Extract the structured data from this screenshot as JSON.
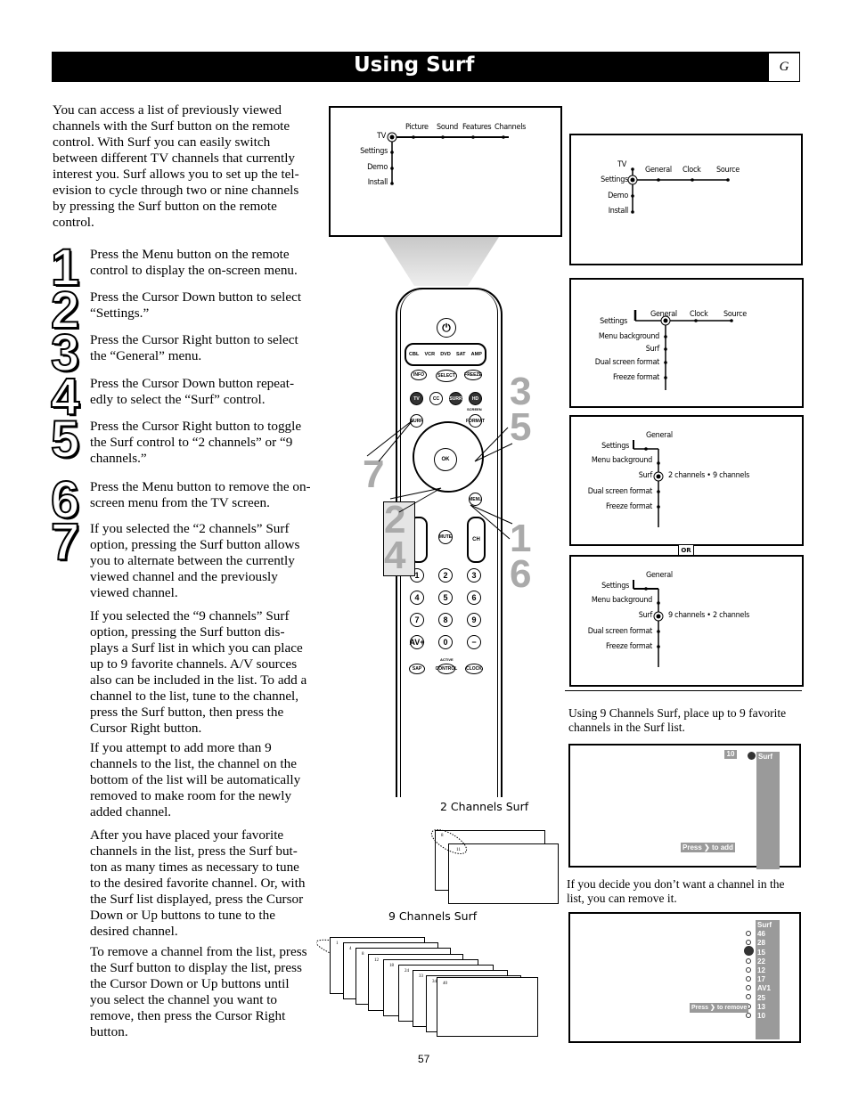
{
  "header": {
    "title": "Using Surf",
    "section_letter": "G"
  },
  "intro": "You can access a list of previously viewed channels with the Surf button on the remote control. With Surf you can easily switch between different TV channels that currently interest you. Surf allows you to set up the tel-evision to cycle through two or nine channels by pressing the Surf button on the remote control.",
  "steps": [
    {
      "num": "1",
      "text": "Press the Menu button on the remote control to display the on-screen menu."
    },
    {
      "num": "2",
      "text": "Press the Cursor Down button to select “Settings.”"
    },
    {
      "num": "3",
      "text": "Press the Cursor Right button to select the “General” menu."
    },
    {
      "num": "4",
      "text": "Press the Cursor Down button repeat-edly to select the “Surf” control."
    },
    {
      "num": "5",
      "text": "Press the Cursor Right button to toggle the Surf control to “2 channels” or “9 channels.”"
    },
    {
      "num": "6",
      "text": "Press the Menu button to remove the on-screen menu from the TV screen."
    },
    {
      "num": "7",
      "text": "If you selected the “2 channels” Surf option, pressing the Surf button allows you to alternate between the currently viewed channel and the previously viewed channel."
    }
  ],
  "paragraphs": [
    "If you selected the “9 channels” Surf option, pressing the Surf button dis-plays a Surf list in which you can place up to 9 favorite channels. A/V sources also can be included in the list. To add a channel to the list, tune to the channel, press the Surf button, then press the Cursor Right button.",
    "If you attempt to add more than 9 channels to the list, the channel on the bottom of the list will be automatically removed to make room for the newly added channel.",
    "After you have placed your favorite channels in the list, press the Surf but-ton as many times as necessary to tune to the desired favorite channel. Or, with the Surf list displayed, press the Cursor Down or Up buttons to tune to the desired channel.",
    "To remove a channel from the list, press the Surf button to display the list, press the Cursor Down or Up buttons until you select the channel you want to remove, then press the Cursor Right button."
  ],
  "menu1": {
    "root": [
      "TV",
      "Settings",
      "Demo",
      "Install"
    ],
    "top": [
      "Picture",
      "Sound",
      "Features",
      "Channels"
    ]
  },
  "menu2": {
    "root": [
      "TV",
      "Settings",
      "Demo",
      "Install"
    ],
    "top": [
      "General",
      "Clock",
      "Source"
    ]
  },
  "menu3": {
    "left": "Settings",
    "top": [
      "General",
      "Clock",
      "Source"
    ],
    "items": [
      "Menu background",
      "Surf",
      "Dual screen format",
      "Freeze format"
    ]
  },
  "menu4": {
    "left": "Settings",
    "top": "General",
    "items": [
      "Menu background",
      "Surf",
      "Dual screen format",
      "Freeze format"
    ],
    "surf_value": "2 channels • 9 channels"
  },
  "or_label": "OR",
  "menu5": {
    "left": "Settings",
    "top": "General",
    "items": [
      "Menu background",
      "Surf",
      "Dual screen format",
      "Freeze format"
    ],
    "surf_value": "9 channels • 2 channels"
  },
  "caption_add": "Using 9 Channels Surf, place up to 9 favorite channels in the Surf list.",
  "screen_add": {
    "channel": "10",
    "list_title": "Surf",
    "prompt": "Press ❯ to add"
  },
  "caption_remove": "If you decide you don’t want a channel in the list, you can remove it.",
  "screen_remove": {
    "list_title": "Surf",
    "channels": [
      "46",
      "28",
      "15",
      "22",
      "12",
      "17",
      "AV1",
      "25",
      "13",
      "10"
    ],
    "selected_index": 2,
    "prompt": "Press ❯ to remove"
  },
  "surf2": {
    "label": "2 Channels Surf",
    "channels": [
      "8",
      "11"
    ]
  },
  "surf9": {
    "label": "9 Channels Surf",
    "channels": [
      "1",
      "4",
      "8",
      "12",
      "18",
      "24",
      "33",
      "34",
      "40"
    ]
  },
  "remote": {
    "sources": [
      "CBL",
      "VCR",
      "DVD",
      "SAT",
      "AMP"
    ],
    "buttons": {
      "info": "INFO",
      "select": "SELECT",
      "freeze": "FREEZE",
      "tv": "TV",
      "cc": "CC",
      "surr": "SURR",
      "hd": "HD",
      "surf": "SURF",
      "format": "FORMAT",
      "screen": "SCREEN",
      "ok": "OK",
      "menu": "MENU",
      "mute": "MUTE",
      "ch": "CH",
      "sap": "SAP",
      "active": "ACTIVE",
      "control": "CONTROL",
      "clock": "CLOCK"
    },
    "digits": [
      "1",
      "2",
      "3",
      "4",
      "5",
      "6",
      "7",
      "8",
      "9",
      "AV+",
      "0",
      "−"
    ]
  },
  "callouts": {
    "a": "3 5",
    "b": "7",
    "c": "2 4",
    "d": "1 6"
  },
  "page_number": "57"
}
